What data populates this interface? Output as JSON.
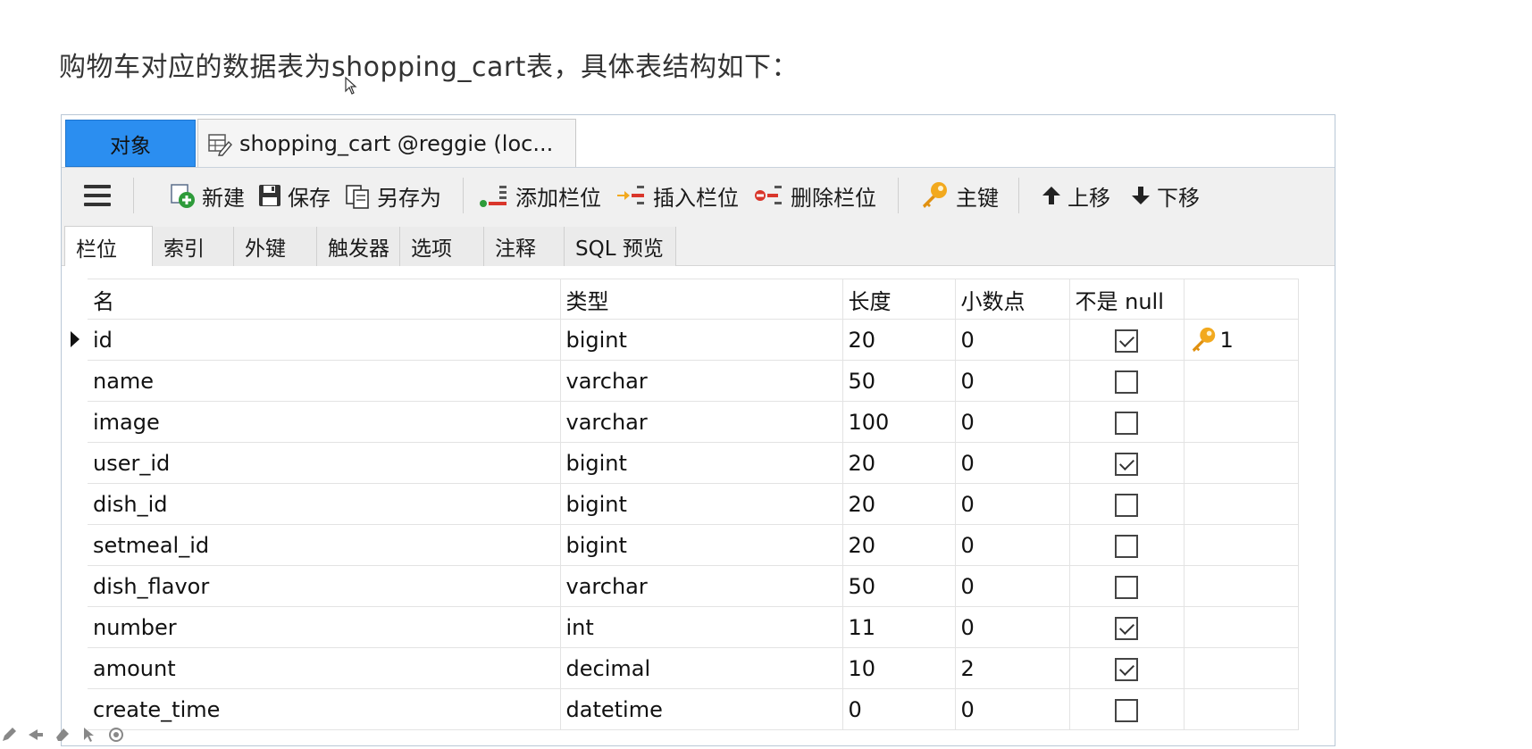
{
  "heading": "购物车对应的数据表为shopping_cart表，具体表结构如下：",
  "tabs": {
    "objects": "对象",
    "document": "shopping_cart @reggie (loc..."
  },
  "toolbar": {
    "new": "新建",
    "save": "保存",
    "save_as": "另存为",
    "add_field": "添加栏位",
    "insert_field": "插入栏位",
    "delete_field": "删除栏位",
    "primary_key": "主键",
    "move_up": "上移",
    "move_down": "下移"
  },
  "subtabs": [
    "栏位",
    "索引",
    "外键",
    "触发器",
    "选项",
    "注释",
    "SQL 预览"
  ],
  "grid": {
    "headers": [
      "名",
      "类型",
      "长度",
      "小数点",
      "不是 null",
      ""
    ],
    "rows": [
      {
        "name": "id",
        "type": "bigint",
        "length": "20",
        "decimals": "0",
        "not_null": true,
        "key": "1"
      },
      {
        "name": "name",
        "type": "varchar",
        "length": "50",
        "decimals": "0",
        "not_null": false,
        "key": ""
      },
      {
        "name": "image",
        "type": "varchar",
        "length": "100",
        "decimals": "0",
        "not_null": false,
        "key": ""
      },
      {
        "name": "user_id",
        "type": "bigint",
        "length": "20",
        "decimals": "0",
        "not_null": true,
        "key": ""
      },
      {
        "name": "dish_id",
        "type": "bigint",
        "length": "20",
        "decimals": "0",
        "not_null": false,
        "key": ""
      },
      {
        "name": "setmeal_id",
        "type": "bigint",
        "length": "20",
        "decimals": "0",
        "not_null": false,
        "key": ""
      },
      {
        "name": "dish_flavor",
        "type": "varchar",
        "length": "50",
        "decimals": "0",
        "not_null": false,
        "key": ""
      },
      {
        "name": "number",
        "type": "int",
        "length": "11",
        "decimals": "0",
        "not_null": true,
        "key": ""
      },
      {
        "name": "amount",
        "type": "decimal",
        "length": "10",
        "decimals": "2",
        "not_null": true,
        "key": ""
      },
      {
        "name": "create_time",
        "type": "datetime",
        "length": "0",
        "decimals": "0",
        "not_null": false,
        "key": ""
      }
    ]
  },
  "colors": {
    "active_tab": "#2b8ef0",
    "toolbar_bg": "#f0f0f0",
    "key_icon": "#f2a91e",
    "add_icon": "#2e9b3a",
    "delete_icon": "#d9362b"
  }
}
